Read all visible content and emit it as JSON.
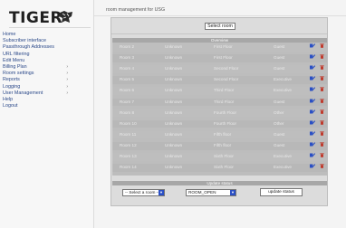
{
  "app": {
    "logo_text": "TIGER"
  },
  "page": {
    "title": "room management for USG"
  },
  "sidebar": {
    "items": [
      {
        "label": "Home",
        "submenu": false
      },
      {
        "label": "Subscriber interface",
        "submenu": false
      },
      {
        "label": "Passthrough Addresses",
        "submenu": false
      },
      {
        "label": "URL filtering",
        "submenu": false
      },
      {
        "label": "Edit Menu",
        "submenu": false
      },
      {
        "label": "Billing Plan",
        "submenu": true
      },
      {
        "label": "Room settings",
        "submenu": true
      },
      {
        "label": "Reports",
        "submenu": true
      },
      {
        "label": "Logging",
        "submenu": true
      },
      {
        "label": "User Management",
        "submenu": true
      },
      {
        "label": "Help",
        "submenu": false
      },
      {
        "label": "Logout",
        "submenu": false
      }
    ]
  },
  "main": {
    "select_button_label": "Select room",
    "overview_title": "Overview",
    "rooms": [
      {
        "name": "Room 2",
        "status": "Unknown",
        "floor": "First Floor",
        "type": "Guest"
      },
      {
        "name": "Room 3",
        "status": "Unknown",
        "floor": "First Floor",
        "type": "Guest"
      },
      {
        "name": "Room 4",
        "status": "Unknown",
        "floor": "Second Floor",
        "type": "Guest"
      },
      {
        "name": "Room 5",
        "status": "Unknown",
        "floor": "Second Floor",
        "type": "Executive"
      },
      {
        "name": "Room 6",
        "status": "Unknown",
        "floor": "Third Floor",
        "type": "Executive"
      },
      {
        "name": "Room 7",
        "status": "Unknown",
        "floor": "Third Floor",
        "type": "Guest"
      },
      {
        "name": "Room 8",
        "status": "Unknown",
        "floor": "Fourth Floor",
        "type": "Other"
      },
      {
        "name": "Room 10",
        "status": "Unknown",
        "floor": "Fourth Floor",
        "type": "Other"
      },
      {
        "name": "Room 11",
        "status": "Unknown",
        "floor": "Fifth floor",
        "type": "Guest"
      },
      {
        "name": "Room 12",
        "status": "Unknown",
        "floor": "Fifth floor",
        "type": "Guest"
      },
      {
        "name": "Room 13",
        "status": "Unknown",
        "floor": "Sixth Floor",
        "type": "Executive"
      },
      {
        "name": "Room 14",
        "status": "Unknown",
        "floor": "Sixth Floor",
        "type": "Executive"
      }
    ],
    "update_status_title": "Update status",
    "room_select_value": "-- Select a room --",
    "status_select_value": "ROOM_OPEN",
    "update_button_label": "update status"
  },
  "colors": {
    "link": "#2c4a8a",
    "edit_icon": "#2a4fc4",
    "delete_icon": "#c0392b",
    "select_arrow": "#2a4fc4"
  },
  "icons": {
    "edit": "edit-icon",
    "delete": "trash-icon",
    "logo": "tiger-logo-icon"
  }
}
